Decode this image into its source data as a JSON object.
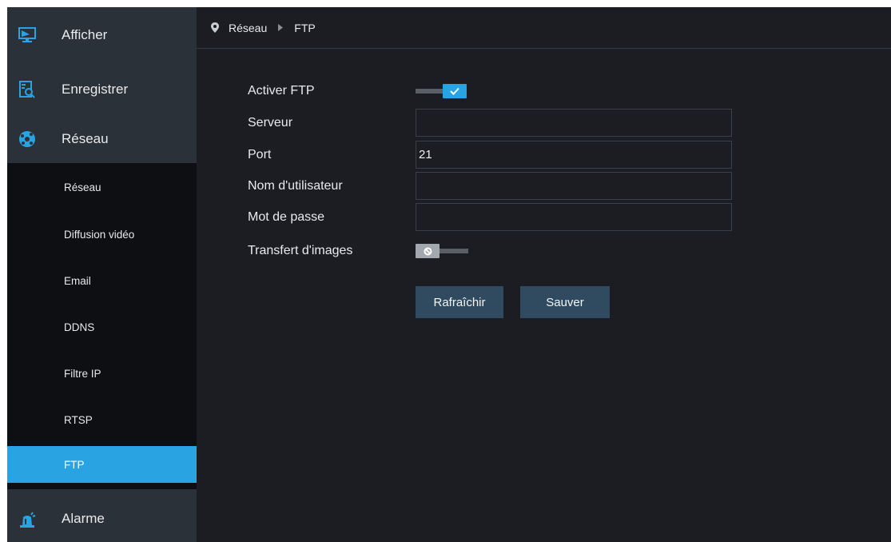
{
  "sidebar": {
    "top_items": [
      {
        "label": "Afficher",
        "icon": "monitor-icon"
      },
      {
        "label": "Enregistrer",
        "icon": "record-search-icon"
      },
      {
        "label": "Réseau",
        "icon": "network-globe-icon"
      }
    ],
    "sub_items": [
      {
        "label": "Réseau"
      },
      {
        "label": "Diffusion vidéo"
      },
      {
        "label": "Email"
      },
      {
        "label": "DDNS"
      },
      {
        "label": "Filtre IP"
      },
      {
        "label": "RTSP"
      },
      {
        "label": "FTP",
        "active": true
      }
    ],
    "bottom_item": {
      "label": "Alarme",
      "icon": "alarm-siren-icon"
    }
  },
  "breadcrumb": {
    "section": "Réseau",
    "page": "FTP"
  },
  "form": {
    "enable_ftp": {
      "label": "Activer FTP",
      "on": true
    },
    "server": {
      "label": "Serveur",
      "value": ""
    },
    "port": {
      "label": "Port",
      "value": "21"
    },
    "username": {
      "label": "Nom d'utilisateur",
      "value": ""
    },
    "password": {
      "label": "Mot de passe",
      "value": ""
    },
    "image_transfer": {
      "label": "Transfert d'images",
      "on": false
    }
  },
  "buttons": {
    "refresh_label": "Rafraîchir",
    "save_label": "Sauver"
  },
  "colors": {
    "accent": "#2aa3e3",
    "sidebar_bg": "#2b3138",
    "submenu_bg": "#0d0f12",
    "main_bg": "#1b1d22",
    "button_bg": "#304a60"
  }
}
